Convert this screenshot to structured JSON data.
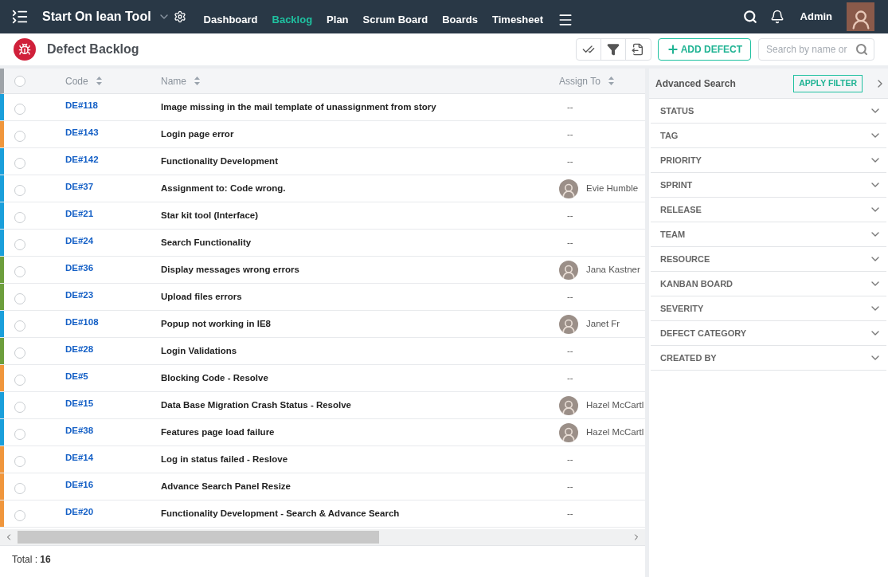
{
  "navbar": {
    "app_title": "Start On lean Tool",
    "menu": [
      {
        "label": "Dashboard",
        "selected": false
      },
      {
        "label": "Backlog",
        "selected": true
      },
      {
        "label": "Plan",
        "selected": false
      },
      {
        "label": "Scrum Board",
        "selected": false
      },
      {
        "label": "Boards",
        "selected": false
      },
      {
        "label": "Timesheet",
        "selected": false
      }
    ],
    "user": "Admin"
  },
  "page_header": {
    "title": "Defect Backlog",
    "add_button": "ADD DEFECT",
    "search": {
      "placeholder": "Search by name or"
    }
  },
  "table": {
    "columns": [
      "Code",
      "Name",
      "Assign To"
    ],
    "select_all_checked": false,
    "rows": [
      {
        "color": "#1a9fdb",
        "checked": false,
        "code": "DE#118",
        "name": "Image missing in the mail template of unassignment from story",
        "assignee": "--",
        "avatar": false
      },
      {
        "color": "#f0963c",
        "checked": false,
        "code": "DE#143",
        "name": "Login page error",
        "assignee": "--",
        "avatar": false
      },
      {
        "color": "#1a9fdb",
        "checked": false,
        "code": "DE#142",
        "name": "Functionality Development",
        "assignee": "--",
        "avatar": false
      },
      {
        "color": "#1a9fdb",
        "checked": false,
        "code": "DE#37",
        "name": "Assignment to: Code wrong.",
        "assignee": "Evie Humble",
        "avatar": true
      },
      {
        "color": "#1a9fdb",
        "checked": false,
        "code": "DE#21",
        "name": "Star kit tool (Interface)",
        "assignee": "--",
        "avatar": false
      },
      {
        "color": "#1a9fdb",
        "checked": false,
        "code": "DE#24",
        "name": "Search Functionality",
        "assignee": "--",
        "avatar": false
      },
      {
        "color": "#6c9e3c",
        "checked": false,
        "code": "DE#36",
        "name": "Display messages wrong errors",
        "assignee": "Jana Kastner",
        "avatar": true
      },
      {
        "color": "#6c9e3c",
        "checked": false,
        "code": "DE#23",
        "name": "Upload files errors",
        "assignee": "--",
        "avatar": false
      },
      {
        "color": "#1a9fdb",
        "checked": false,
        "code": "DE#108",
        "name": "Popup not working in IE8",
        "assignee": "Janet Fr",
        "avatar": true
      },
      {
        "color": "#6c9e3c",
        "checked": false,
        "code": "DE#28",
        "name": "Login Validations",
        "assignee": "--",
        "avatar": false
      },
      {
        "color": "#f0963c",
        "checked": false,
        "code": "DE#5",
        "name": "Blocking Code - Resolve",
        "assignee": "--",
        "avatar": false
      },
      {
        "color": "#1a9fdb",
        "checked": false,
        "code": "DE#15",
        "name": "Data Base Migration Crash Status - Resolve",
        "assignee": "Hazel McCartl",
        "avatar": true
      },
      {
        "color": "#1a9fdb",
        "checked": false,
        "code": "DE#38",
        "name": "Features page load failure",
        "assignee": "Hazel McCartl",
        "avatar": true
      },
      {
        "color": "#f0963c",
        "checked": false,
        "code": "DE#14",
        "name": "Log in status failed - Reslove",
        "assignee": "--",
        "avatar": false
      },
      {
        "color": "#f0963c",
        "checked": false,
        "code": "DE#16",
        "name": "Advance Search Panel Resize",
        "assignee": "--",
        "avatar": false
      },
      {
        "color": "#f0963c",
        "checked": false,
        "code": "DE#20",
        "name": "Functionality Development - Search & Advance Search",
        "assignee": "--",
        "avatar": false
      }
    ],
    "total": "Total : **16**"
  },
  "advanced_search": {
    "title": "Advanced Search",
    "apply_button": "APPLY FILTER",
    "filters": [
      "STATUS",
      "TAG",
      "PRIORITY",
      "SPRINT",
      "RELEASE",
      "TEAM",
      "RESOURCE",
      "KANBAN BOARD",
      "SEVERITY",
      "DEFECT CATEGORY",
      "CREATED BY"
    ]
  }
}
